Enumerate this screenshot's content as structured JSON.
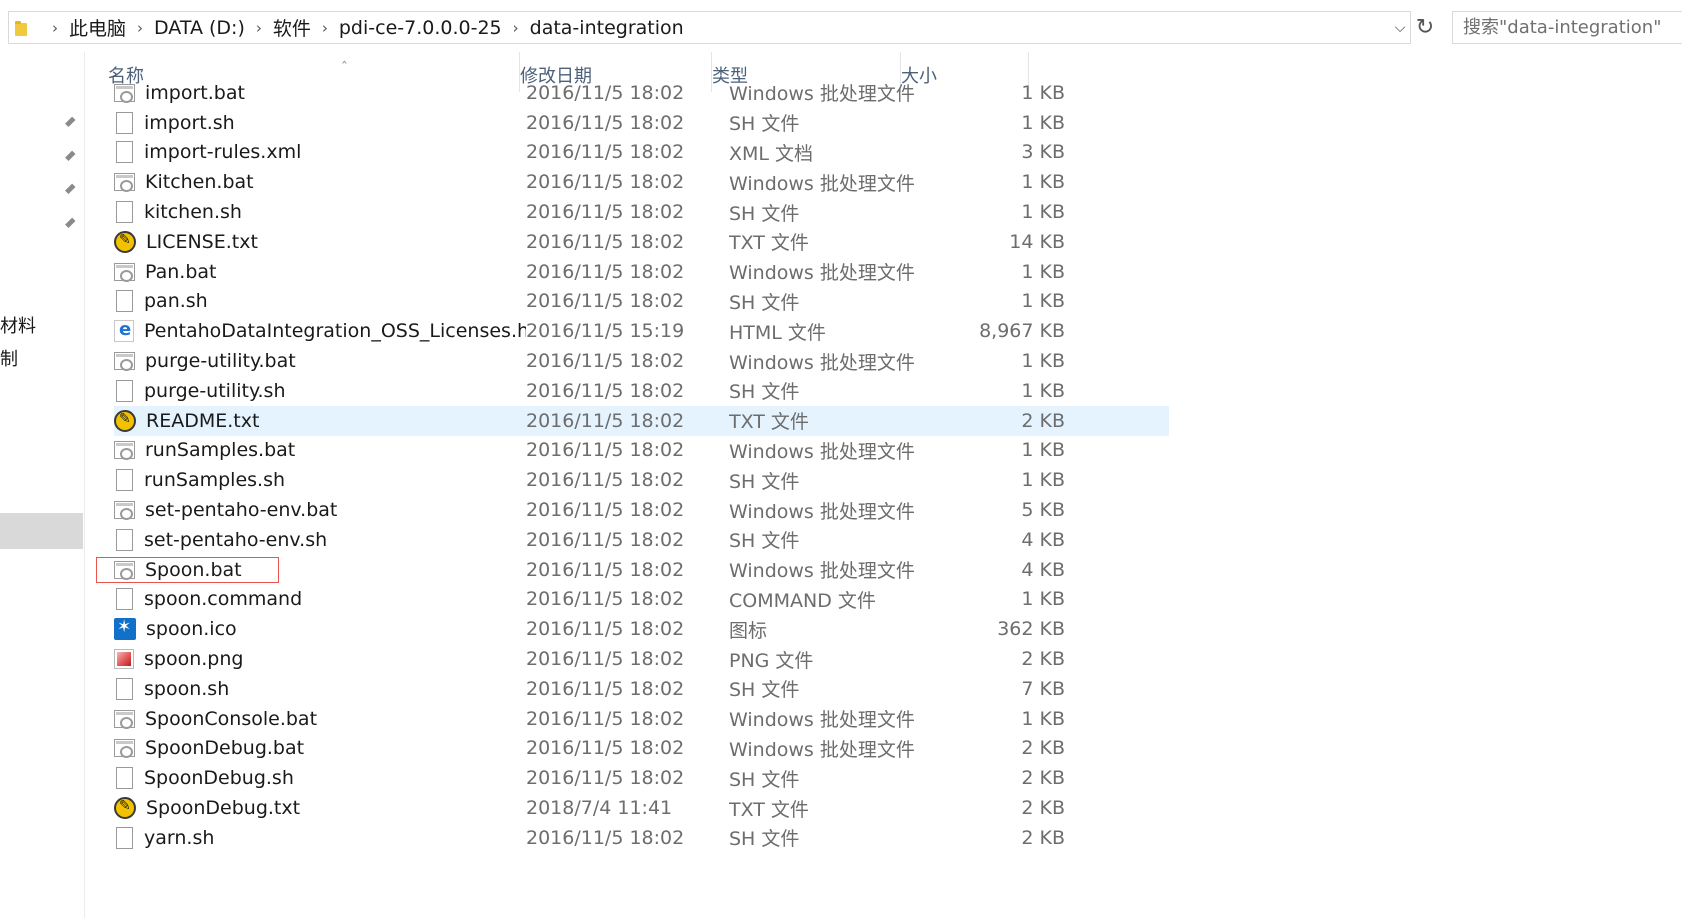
{
  "address_bar": {
    "crumbs": [
      "此电脑",
      "DATA (D:)",
      "软件",
      "pdi-ce-7.0.0.0-25",
      "data-integration"
    ]
  },
  "search": {
    "placeholder": "搜索\"data-integration\""
  },
  "nav_pane": {
    "labels": [
      "材料",
      "制"
    ]
  },
  "columns": {
    "name": "名称",
    "date": "修改日期",
    "type": "类型",
    "size": "大小"
  },
  "files": [
    {
      "name": "import.bat",
      "date": "2016/11/5 18:02",
      "type": "Windows 批处理文件",
      "size": "1 KB",
      "icon": "bat-file-icon"
    },
    {
      "name": "import.sh",
      "date": "2016/11/5 18:02",
      "type": "SH 文件",
      "size": "1 KB",
      "icon": "blank-file-icon"
    },
    {
      "name": "import-rules.xml",
      "date": "2016/11/5 18:02",
      "type": "XML 文档",
      "size": "3 KB",
      "icon": "blank-file-icon"
    },
    {
      "name": "Kitchen.bat",
      "date": "2016/11/5 18:02",
      "type": "Windows 批处理文件",
      "size": "1 KB",
      "icon": "bat-file-icon"
    },
    {
      "name": "kitchen.sh",
      "date": "2016/11/5 18:02",
      "type": "SH 文件",
      "size": "1 KB",
      "icon": "blank-file-icon"
    },
    {
      "name": "LICENSE.txt",
      "date": "2016/11/5 18:02",
      "type": "TXT 文件",
      "size": "14 KB",
      "icon": "text-editor-icon"
    },
    {
      "name": "Pan.bat",
      "date": "2016/11/5 18:02",
      "type": "Windows 批处理文件",
      "size": "1 KB",
      "icon": "bat-file-icon"
    },
    {
      "name": "pan.sh",
      "date": "2016/11/5 18:02",
      "type": "SH 文件",
      "size": "1 KB",
      "icon": "blank-file-icon"
    },
    {
      "name": "PentahoDataIntegration_OSS_Licenses.html",
      "date": "2016/11/5 15:19",
      "type": "HTML 文件",
      "size": "8,967 KB",
      "icon": "html-file-icon"
    },
    {
      "name": "purge-utility.bat",
      "date": "2016/11/5 18:02",
      "type": "Windows 批处理文件",
      "size": "1 KB",
      "icon": "bat-file-icon"
    },
    {
      "name": "purge-utility.sh",
      "date": "2016/11/5 18:02",
      "type": "SH 文件",
      "size": "1 KB",
      "icon": "blank-file-icon"
    },
    {
      "name": "README.txt",
      "date": "2016/11/5 18:02",
      "type": "TXT 文件",
      "size": "2 KB",
      "icon": "text-editor-icon",
      "selected": true
    },
    {
      "name": "runSamples.bat",
      "date": "2016/11/5 18:02",
      "type": "Windows 批处理文件",
      "size": "1 KB",
      "icon": "bat-file-icon"
    },
    {
      "name": "runSamples.sh",
      "date": "2016/11/5 18:02",
      "type": "SH 文件",
      "size": "1 KB",
      "icon": "blank-file-icon"
    },
    {
      "name": "set-pentaho-env.bat",
      "date": "2016/11/5 18:02",
      "type": "Windows 批处理文件",
      "size": "5 KB",
      "icon": "bat-file-icon"
    },
    {
      "name": "set-pentaho-env.sh",
      "date": "2016/11/5 18:02",
      "type": "SH 文件",
      "size": "4 KB",
      "icon": "blank-file-icon"
    },
    {
      "name": "Spoon.bat",
      "date": "2016/11/5 18:02",
      "type": "Windows 批处理文件",
      "size": "4 KB",
      "icon": "bat-file-icon",
      "highlighted": true
    },
    {
      "name": "spoon.command",
      "date": "2016/11/5 18:02",
      "type": "COMMAND 文件",
      "size": "1 KB",
      "icon": "blank-file-icon"
    },
    {
      "name": "spoon.ico",
      "date": "2016/11/5 18:02",
      "type": "图标",
      "size": "362 KB",
      "icon": "ico-file-icon"
    },
    {
      "name": "spoon.png",
      "date": "2016/11/5 18:02",
      "type": "PNG 文件",
      "size": "2 KB",
      "icon": "png-file-icon"
    },
    {
      "name": "spoon.sh",
      "date": "2016/11/5 18:02",
      "type": "SH 文件",
      "size": "7 KB",
      "icon": "blank-file-icon"
    },
    {
      "name": "SpoonConsole.bat",
      "date": "2016/11/5 18:02",
      "type": "Windows 批处理文件",
      "size": "1 KB",
      "icon": "bat-file-icon"
    },
    {
      "name": "SpoonDebug.bat",
      "date": "2016/11/5 18:02",
      "type": "Windows 批处理文件",
      "size": "2 KB",
      "icon": "bat-file-icon"
    },
    {
      "name": "SpoonDebug.sh",
      "date": "2016/11/5 18:02",
      "type": "SH 文件",
      "size": "2 KB",
      "icon": "blank-file-icon"
    },
    {
      "name": "SpoonDebug.txt",
      "date": "2018/7/4 11:41",
      "type": "TXT 文件",
      "size": "2 KB",
      "icon": "text-editor-icon"
    },
    {
      "name": "yarn.sh",
      "date": "2016/11/5 18:02",
      "type": "SH 文件",
      "size": "2 KB",
      "icon": "blank-file-icon"
    }
  ],
  "colors": {
    "selection": "#e5f3ff",
    "highlight_box": "#e8554e",
    "header_text": "#4c607a"
  }
}
